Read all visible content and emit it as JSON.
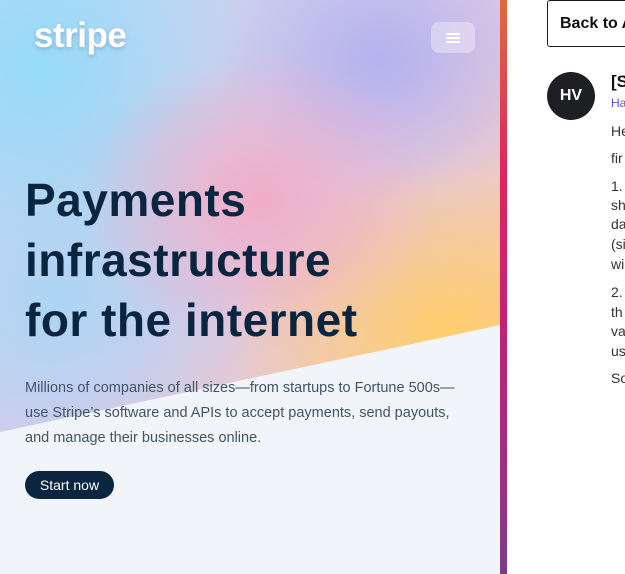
{
  "hero": {
    "logo": "stripe",
    "menu_icon": "hamburger-menu-icon",
    "headline_lines": [
      "Payments",
      "infrastructure",
      "for the internet"
    ],
    "subtext_lines": [
      "Millions of companies of all sizes—from startups to Fortune 500s—",
      "use Stripe’s software and APIs to accept payments, send payouts,",
      "and manage their businesses online."
    ],
    "cta_label": "Start now",
    "colors": {
      "headline": "#0a2540",
      "cta_background": "#0a2540",
      "subtext": "#425466"
    }
  },
  "detail": {
    "back_label": "Back to A",
    "avatar_initials": "HV",
    "title_fragment": "[S",
    "sender_fragment": "Ha",
    "body_fragments": [
      "He",
      "fir",
      "1.",
      "sh",
      "da",
      "(si",
      "wi",
      "2.",
      "th",
      "va",
      "us",
      "So"
    ],
    "colors": {
      "sender": "#6b4fd8",
      "avatar_background": "#1e1f23"
    }
  }
}
